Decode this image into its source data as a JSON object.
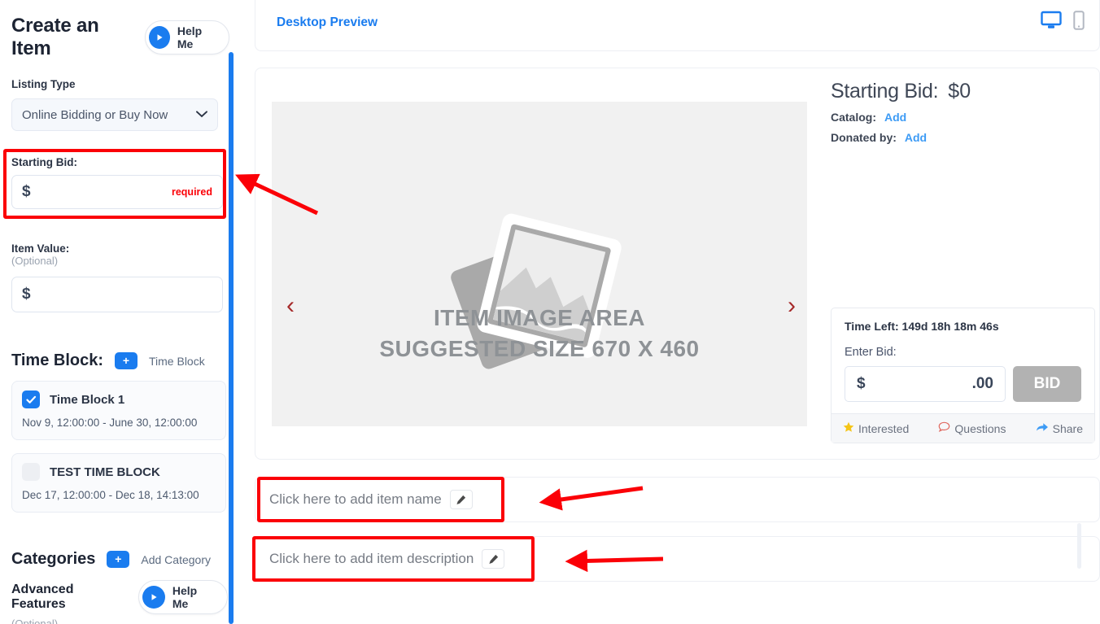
{
  "sidebar": {
    "title": "Create an Item",
    "help_label": "Help Me",
    "listing_type": {
      "label": "Listing Type",
      "value": "Online Bidding or Buy Now"
    },
    "starting_bid": {
      "label": "Starting Bid:",
      "currency": "$",
      "value": "",
      "required_text": "required"
    },
    "item_value": {
      "label": "Item Value:",
      "optional": "(Optional)",
      "currency": "$",
      "value": ""
    },
    "time_block": {
      "title": "Time Block:",
      "add_icon": "+",
      "add_label": "Time Block",
      "blocks": [
        {
          "name": "Time Block 1",
          "dates": "Nov 9, 12:00:00 - June 30, 12:00:00",
          "checked": true
        },
        {
          "name": "TEST TIME BLOCK",
          "dates": "Dec 17, 12:00:00 - Dec 18, 14:13:00",
          "checked": false
        }
      ]
    },
    "categories": {
      "title": "Categories",
      "add_icon": "+",
      "add_label": "Add Category"
    },
    "advanced": {
      "title": "Advanced Features",
      "optional": "(Optional)",
      "help_label": "Help Me"
    }
  },
  "preview": {
    "header_link": "Desktop Preview",
    "devices": {
      "desktop": "desktop-icon",
      "mobile": "mobile-icon",
      "active": "desktop"
    },
    "image_area": {
      "line1": "ITEM IMAGE AREA",
      "line2": "SUGGESTED SIZE 670 X 460",
      "prev_arrow": "‹",
      "next_arrow": "›"
    },
    "bid": {
      "title": "Starting Bid:",
      "amount": "$0",
      "catalog_label": "Catalog:",
      "catalog_action": "Add",
      "donated_label": "Donated by:",
      "donated_action": "Add"
    },
    "bid_box": {
      "time_left": "Time Left: 149d 18h 18m 46s",
      "enter_bid_label": "Enter Bid:",
      "currency": "$",
      "value": "",
      "decimals": ".00",
      "bid_button": "BID",
      "footer": {
        "interested": "Interested",
        "questions": "Questions",
        "share": "Share"
      }
    },
    "item_name_placeholder": "Click here to add item name",
    "item_description_placeholder": "Click here to add item description"
  },
  "colors": {
    "accent_blue": "#1a7cef",
    "link_blue": "#3d9bf5",
    "annotation_red": "#fb0007",
    "bid_button_gray": "#b2b2b2",
    "star_yellow": "#f5c518"
  }
}
